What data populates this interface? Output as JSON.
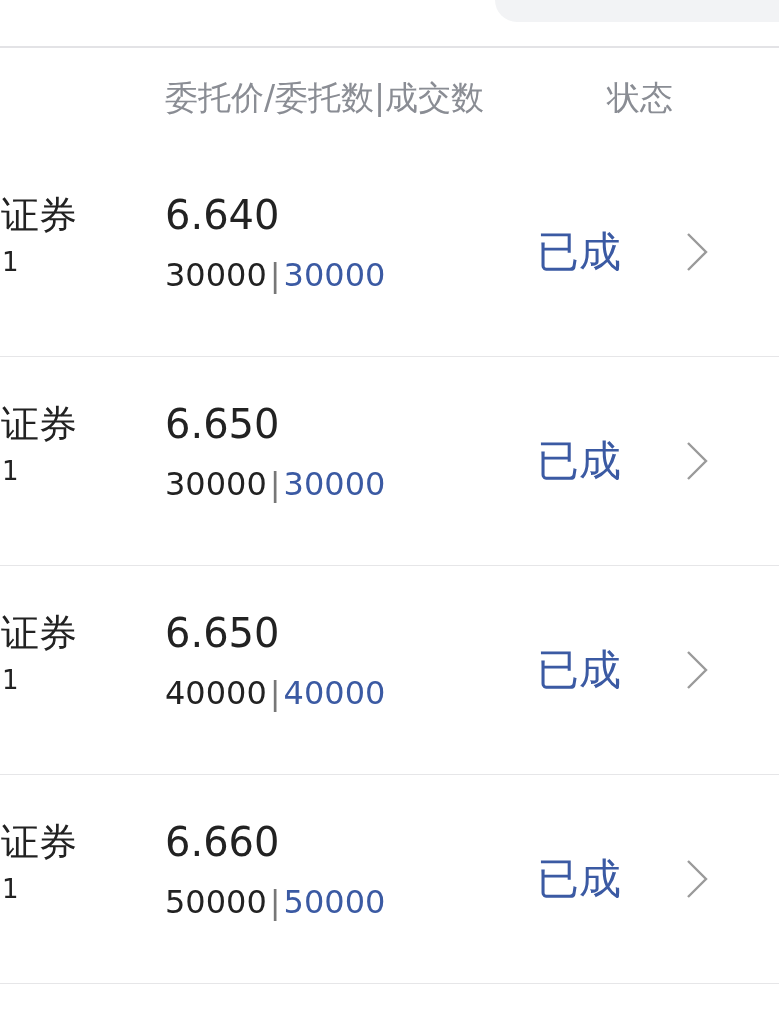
{
  "header": {
    "columns": [
      {
        "label": "委托价/委托数|成交数"
      },
      {
        "label": "状态"
      }
    ]
  },
  "orders": [
    {
      "name": "证券",
      "code": "1",
      "price": "6.640",
      "entrusted": "30000",
      "separator": "|",
      "filled": "30000",
      "status": "已成"
    },
    {
      "name": "证券",
      "code": "1",
      "price": "6.650",
      "entrusted": "30000",
      "separator": "|",
      "filled": "30000",
      "status": "已成"
    },
    {
      "name": "证券",
      "code": "1",
      "price": "6.650",
      "entrusted": "40000",
      "separator": "|",
      "filled": "40000",
      "status": "已成"
    },
    {
      "name": "证券",
      "code": "1",
      "price": "6.660",
      "entrusted": "50000",
      "separator": "|",
      "filled": "50000",
      "status": "已成"
    }
  ]
}
